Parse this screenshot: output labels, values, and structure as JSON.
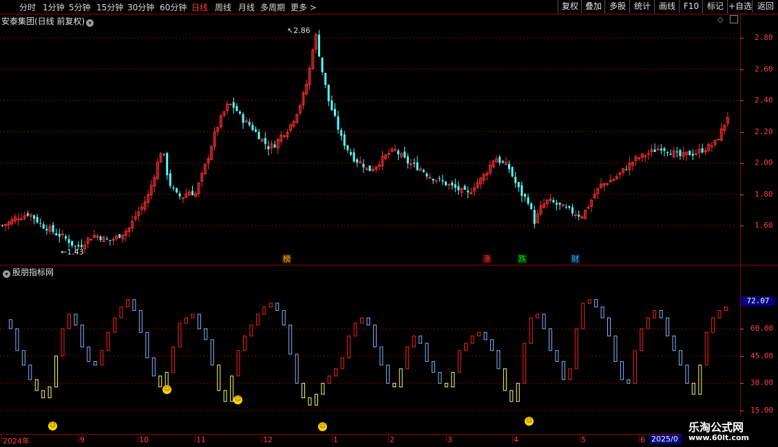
{
  "toolbar": {
    "periods": [
      {
        "label": "分时"
      },
      {
        "label": "1分钟"
      },
      {
        "label": "5分钟"
      },
      {
        "label": "15分钟"
      },
      {
        "label": "30分钟"
      },
      {
        "label": "60分钟"
      },
      {
        "label": "日线"
      },
      {
        "label": "周线"
      },
      {
        "label": "月线"
      },
      {
        "label": "多周期"
      },
      {
        "label": "更多 >"
      }
    ],
    "active_period": "日线",
    "right_buttons": [
      {
        "label": "复权"
      },
      {
        "label": "叠加"
      },
      {
        "label": "多股"
      },
      {
        "label": "统计"
      },
      {
        "label": "画线"
      },
      {
        "label": "F10"
      },
      {
        "label": "标记"
      },
      {
        "label": "+自选"
      },
      {
        "label": "返回"
      }
    ]
  },
  "main_panel": {
    "title": "安泰集团(日线 前复权)",
    "high_label": "2.86",
    "low_label": "1.43",
    "events": [
      {
        "text": "榜",
        "color": "#ffb000"
      },
      {
        "text": "涨",
        "color": "#ff4040"
      },
      {
        "text": "跌",
        "color": "#00d000"
      },
      {
        "text": "财",
        "color": "#40b0ff"
      }
    ]
  },
  "indicator_panel": {
    "title": "股朋指标网",
    "current_value": "72.07"
  },
  "time_axis": {
    "labels": [
      "2024年",
      "9",
      "10",
      "11",
      "12",
      "1",
      "2",
      "3",
      "4",
      "5",
      "6"
    ],
    "year_box": "2025/0"
  },
  "watermark": {
    "line1": "乐淘公式网",
    "line2": "www.60lt.com"
  },
  "colors": {
    "up": "#ff3030",
    "down": "#54ffff",
    "indicator_up": "#ff2020",
    "indicator_down": "#7fb8ff",
    "signal": "#ffff66",
    "grid": "#8b0000"
  },
  "chart_data": [
    {
      "type": "candlestick",
      "title": "安泰集团(日线 前复权)",
      "ylim": [
        1.5,
        2.9
      ],
      "y_ticks": [
        1.6,
        1.8,
        2.0,
        2.2,
        2.4,
        2.6,
        2.8
      ],
      "high": 2.86,
      "low": 1.43,
      "close_series": [
        1.6,
        1.62,
        1.65,
        1.66,
        1.68,
        1.64,
        1.6,
        1.58,
        1.55,
        1.53,
        1.5,
        1.46,
        1.48,
        1.52,
        1.54,
        1.52,
        1.5,
        1.52,
        1.55,
        1.58,
        1.66,
        1.72,
        1.8,
        1.95,
        2.1,
        1.88,
        1.8,
        1.78,
        1.82,
        1.8,
        1.92,
        2.05,
        2.2,
        2.3,
        2.38,
        2.35,
        2.28,
        2.25,
        2.2,
        2.15,
        2.1,
        2.12,
        2.18,
        2.22,
        2.3,
        2.4,
        2.55,
        2.84,
        2.6,
        2.4,
        2.28,
        2.15,
        2.08,
        2.02,
        2.0,
        1.95,
        1.98,
        2.02,
        2.06,
        2.08,
        2.04,
        2.0,
        1.98,
        1.96,
        1.92,
        1.9,
        1.88,
        1.86,
        1.84,
        1.82,
        1.8,
        1.86,
        1.9,
        1.96,
        2.04,
        2.0,
        1.98,
        1.88,
        1.8,
        1.76,
        1.62,
        1.72,
        1.76,
        1.74,
        1.72,
        1.7,
        1.68,
        1.66,
        1.72,
        1.8,
        1.86,
        1.88,
        1.9,
        1.94,
        1.98,
        2.02,
        2.04,
        2.06,
        2.08,
        2.1,
        2.08,
        2.06,
        2.04,
        2.06,
        2.06,
        2.08,
        2.1,
        2.12,
        2.2,
        2.3
      ],
      "x_labels": [
        "2024年",
        "9",
        "10",
        "11",
        "12",
        "1",
        "2",
        "3",
        "4",
        "5",
        "6"
      ]
    },
    {
      "type": "line",
      "title": "股朋指标网",
      "ylim": [
        15,
        80
      ],
      "y_ticks": [
        15.0,
        30.0,
        45.0,
        60.0
      ],
      "current": 72.07,
      "series": [
        {
          "values": [
            65,
            60,
            48,
            40,
            32,
            26,
            22,
            28,
            45,
            60,
            68,
            62,
            50,
            42,
            40,
            48,
            58,
            66,
            72,
            76,
            70,
            58,
            44,
            34,
            28,
            36,
            50,
            63,
            66,
            68,
            60,
            54,
            40,
            26,
            20,
            34,
            48,
            56,
            62,
            68,
            72,
            74,
            70,
            62,
            46,
            30,
            22,
            18,
            24,
            30,
            34,
            38,
            44,
            56,
            63,
            66,
            62,
            50,
            40,
            30,
            28,
            38,
            50,
            56,
            52,
            42,
            36,
            30,
            28,
            36,
            48,
            52,
            56,
            58,
            54,
            48,
            38,
            26,
            20,
            30,
            52,
            66,
            68,
            60,
            48,
            42,
            32,
            38,
            60,
            74,
            76,
            72,
            66,
            56,
            42,
            32,
            30,
            48,
            60,
            66,
            70,
            66,
            56,
            48,
            40,
            30,
            24,
            40,
            58,
            66,
            70,
            72
          ]
        }
      ]
    }
  ]
}
